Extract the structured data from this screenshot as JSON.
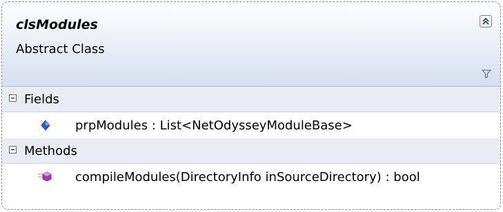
{
  "class": {
    "name": "clsModules",
    "stereotype": "Abstract Class"
  },
  "icons": {
    "collapse": "double-chevron-up-icon",
    "filter": "filter-funnel-icon",
    "field": "blue-field-diamond-icon",
    "method": "purple-method-cube-icon",
    "section_toggle": "minus-box-icon"
  },
  "colors": {
    "header_gradient_top": "#ffffff",
    "header_gradient_bottom": "#d6dff0",
    "field_icon": "#2f5fd0",
    "method_icon": "#9b3fb5"
  },
  "compartments": [
    {
      "label": "Fields",
      "members": [
        {
          "text": "prpModules : List<NetOdysseyModuleBase>"
        }
      ]
    },
    {
      "label": "Methods",
      "members": [
        {
          "text": "compileModules(DirectoryInfo inSourceDirectory) : bool"
        }
      ]
    }
  ]
}
